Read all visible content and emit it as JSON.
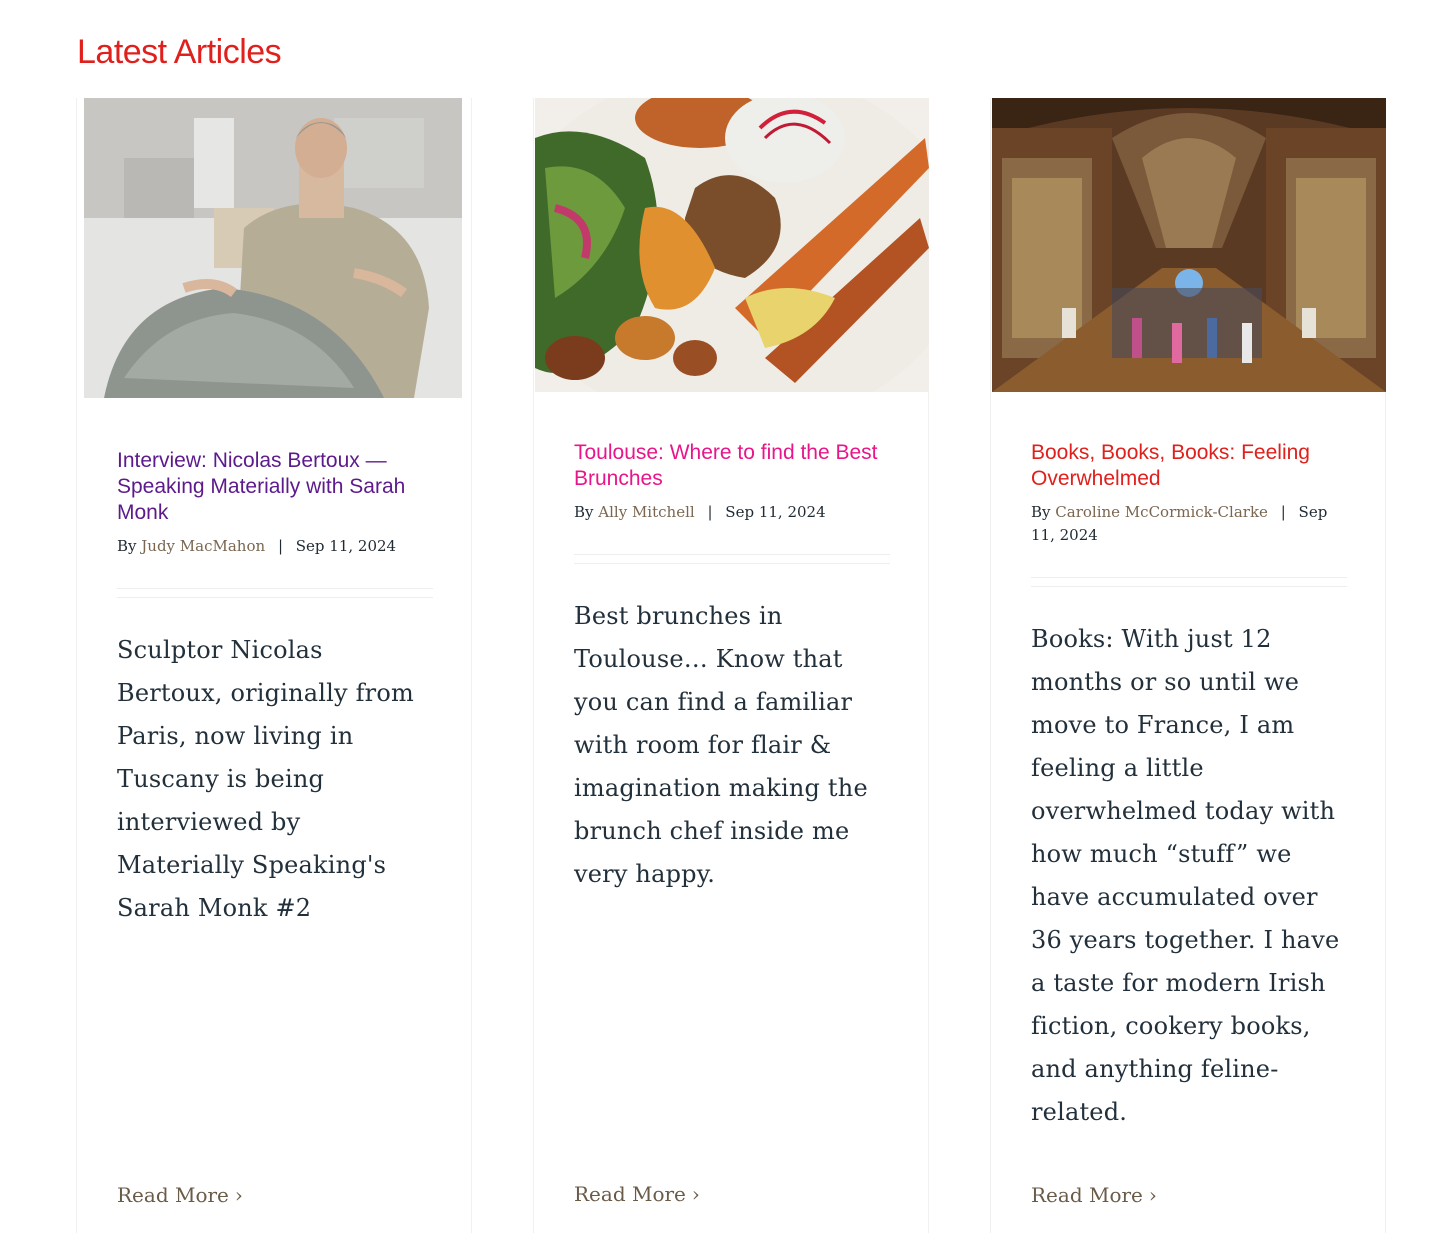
{
  "section": {
    "heading": "Latest Articles",
    "heading_color": "#e0201c"
  },
  "articles": [
    {
      "title": "Interview: Nicolas Bertoux — Speaking Materially with Sarah Monk",
      "title_color": "#5c1a8c",
      "by_label": "By",
      "author": "Judy MacMahon",
      "separator": "|",
      "date": "Sep 11, 2024",
      "excerpt": "Sculptor Nicolas Bertoux, originally from Paris, now living in Tuscany is being interviewed by Materially Speaking's Sarah Monk #2",
      "read_more": "Read More",
      "chevron": "›",
      "image_subject": "sculptor-photo"
    },
    {
      "title": "Toulouse: Where to find the Best Brunches",
      "title_color": "#e8168a",
      "by_label": "By",
      "author": "Ally Mitchell",
      "separator": "|",
      "date": "Sep 11, 2024",
      "excerpt": "Best brunches in Toulouse… Know that you can find a familiar with room for flair & imagination making the brunch chef inside me very happy.",
      "read_more": "Read More",
      "chevron": "›",
      "image_subject": "brunch-plate-photo"
    },
    {
      "title": "Books, Books, Books: Feeling Overwhelmed",
      "title_color": "#e0201c",
      "by_label": "By",
      "author": "Caroline McCormick-Clarke",
      "separator": "|",
      "date": "Sep 11, 2024",
      "excerpt": "Books: With just 12 months or so until we move to France, I am feeling a little overwhelmed today with how much “stuff” we have accumulated over 36 years together. I have a taste for modern Irish fiction, cookery books, and anything feline-related.",
      "read_more": "Read More",
      "chevron": "›",
      "image_subject": "library-hall-photo"
    }
  ]
}
